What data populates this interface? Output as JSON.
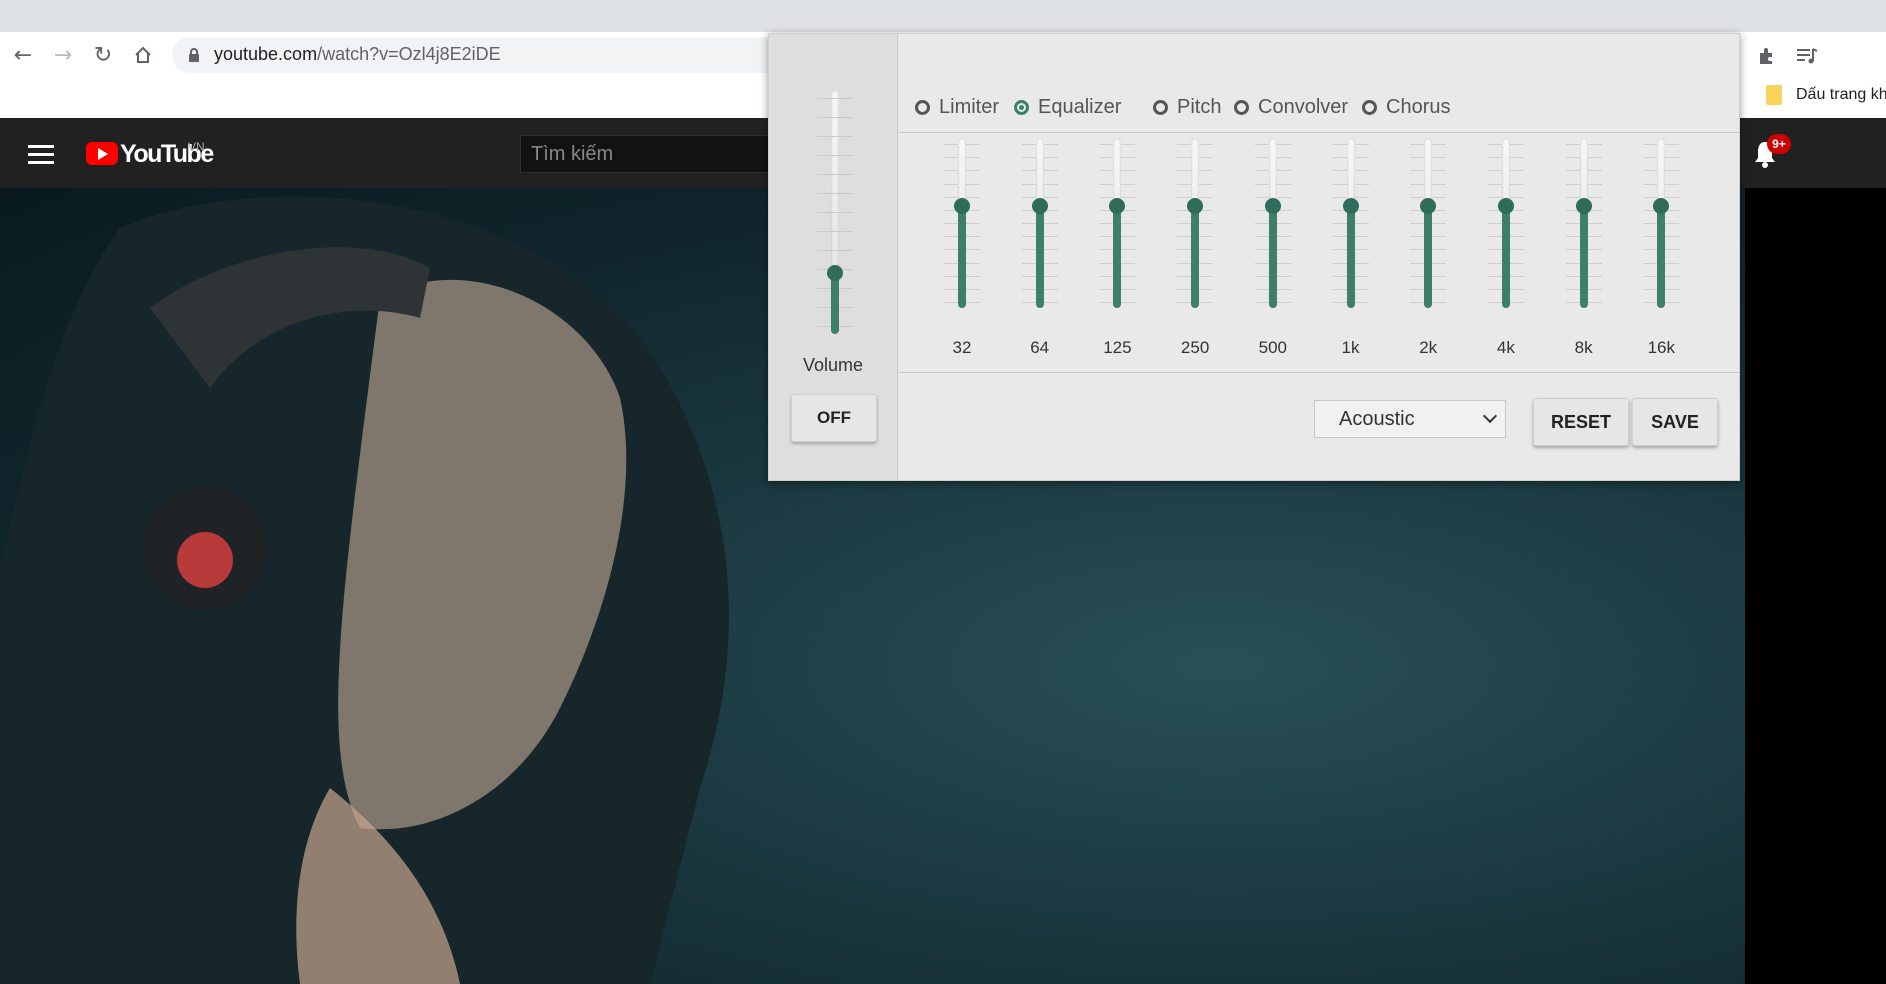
{
  "browser": {
    "url_host": "youtube.com",
    "url_path": "/watch?v=Ozl4j8E2iDE",
    "bookmark_label": "Dấu trang khá",
    "icons": [
      "back-icon",
      "forward-icon",
      "reload-icon",
      "home-icon",
      "lock-icon",
      "extensions-icon",
      "reading-list-icon",
      "bookmark-folder-icon"
    ]
  },
  "youtube": {
    "logo_text": "YouTube",
    "region": "VN",
    "search_placeholder": "Tìm kiếm",
    "notification_count": "9+"
  },
  "equalizer": {
    "accent_color": "#3d7f6d",
    "modes": [
      {
        "label": "Limiter",
        "selected": false
      },
      {
        "label": "Equalizer",
        "selected": true
      },
      {
        "label": "Pitch",
        "selected": false
      },
      {
        "label": "Convolver",
        "selected": false
      },
      {
        "label": "Chorus",
        "selected": false
      }
    ],
    "volume": {
      "label": "Volume",
      "level": 0.25
    },
    "bands": [
      {
        "label": "32",
        "level": 0.6
      },
      {
        "label": "64",
        "level": 0.6
      },
      {
        "label": "125",
        "level": 0.6
      },
      {
        "label": "250",
        "level": 0.6
      },
      {
        "label": "500",
        "level": 0.6
      },
      {
        "label": "1k",
        "level": 0.6
      },
      {
        "label": "2k",
        "level": 0.6
      },
      {
        "label": "4k",
        "level": 0.6
      },
      {
        "label": "8k",
        "level": 0.6
      },
      {
        "label": "16k",
        "level": 0.6
      }
    ],
    "off_label": "OFF",
    "preset_value": "Acoustic",
    "reset_label": "RESET",
    "save_label": "SAVE"
  }
}
